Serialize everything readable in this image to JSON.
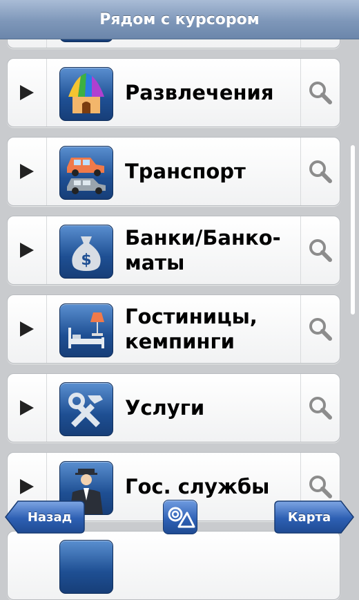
{
  "header": {
    "title": "Рядом с курсором"
  },
  "categories": [
    {
      "label": "Развлечения",
      "icon": "circus-tent-icon"
    },
    {
      "label": "Транспорт",
      "icon": "cars-icon"
    },
    {
      "label": "Банки/Банко-\nматы",
      "icon": "money-bag-icon"
    },
    {
      "label": "Гостиницы,\nкемпинги",
      "icon": "hotel-bed-icon"
    },
    {
      "label": "Услуги",
      "icon": "tools-icon"
    },
    {
      "label": "Гос. службы",
      "icon": "official-icon"
    }
  ],
  "footer": {
    "back_label": "Назад",
    "map_label": "Карта",
    "center_icon": "navigation-icon"
  },
  "colors": {
    "header_blue": "#7e97b9",
    "icon_blue": "#1e4f93",
    "footer_blue": "#2d5fb3"
  }
}
